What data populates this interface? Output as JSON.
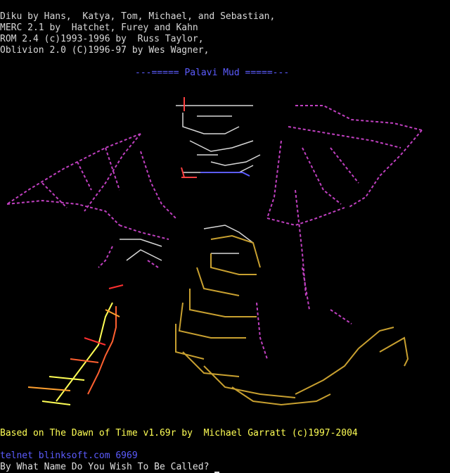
{
  "credits": [
    "Diku by Hans,  Katya, Tom, Michael, and Sebastian,",
    "MERC 2.1 by  Hatchet, Furey and Kahn",
    "ROM 2.4 (c)1993-1996 by  Russ Taylor,",
    "Oblivion 2.0 (C)1996-97 by Wes Wagner,"
  ],
  "title": "---===== Palavi Mud =====---",
  "art_description_icon": "dragon-ascii-art",
  "footer": {
    "based_on": "Based on The Dawn of Time v1.69r by  Michael Garratt (c)1997-2004",
    "telnet": "telnet blinksoft.com 6969",
    "prompt": "By What Name Do You Wish To Be Called?"
  },
  "colors": {
    "background": "#000000",
    "text": "#d8d8d8",
    "title": "#5c5cff",
    "wings": "#c040c0",
    "body": "#c8a030",
    "rider": "#d8d8d8",
    "fire": "#ff3030"
  }
}
